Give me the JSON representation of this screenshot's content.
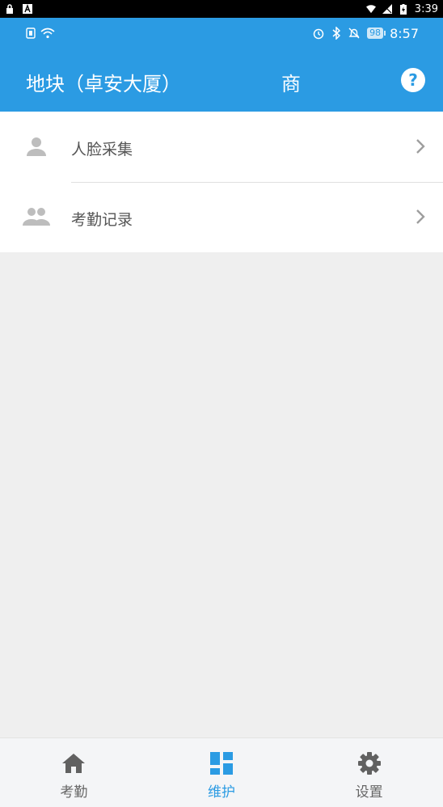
{
  "system_bar": {
    "time": "3:39"
  },
  "inner_status": {
    "battery": "98",
    "time": "8:57"
  },
  "header": {
    "title": "地块（卓安大厦）",
    "title_extra": "商",
    "help_label": "?",
    "color": "#2b9be3"
  },
  "list": {
    "items": [
      {
        "label": "人脸采集",
        "icon": "person-icon"
      },
      {
        "label": "考勤记录",
        "icon": "people-icon"
      }
    ]
  },
  "bottom_nav": {
    "items": [
      {
        "label": "考勤",
        "icon": "home-icon",
        "active": false
      },
      {
        "label": "维护",
        "icon": "dashboard-icon",
        "active": true
      },
      {
        "label": "设置",
        "icon": "gear-icon",
        "active": false
      }
    ],
    "active_color": "#2b9be3"
  }
}
